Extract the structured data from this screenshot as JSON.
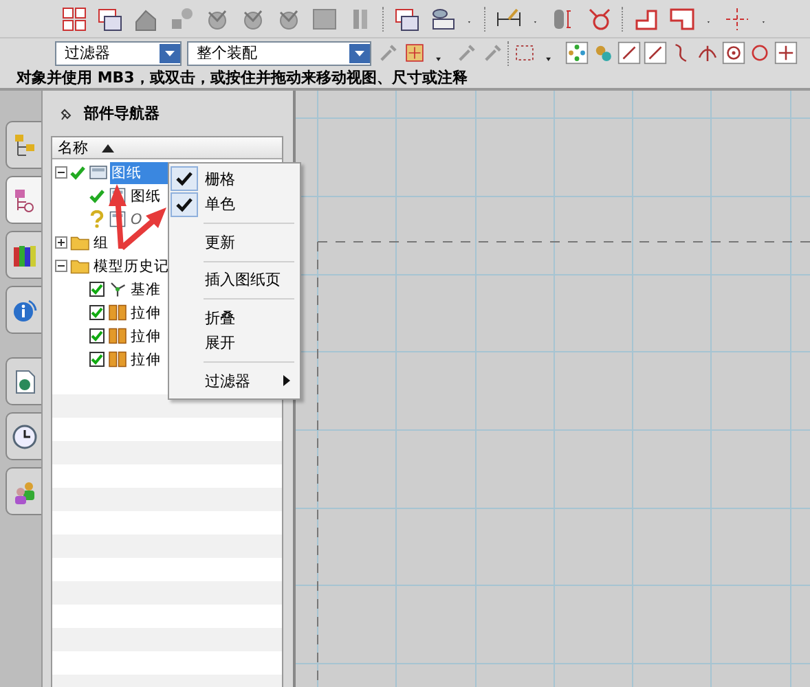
{
  "toolbar": {
    "filter_dropdown": {
      "value": "过滤器"
    },
    "assembly_dropdown": {
      "value": "整个装配"
    }
  },
  "cue_line": "对象并使用 MB3，或双击，或按住并拖动来移动视图、尺寸或注释",
  "resource_bar": {
    "tabs": [
      {
        "selected": false
      },
      {
        "selected": true
      },
      {
        "selected": false
      },
      {
        "selected": false
      },
      {
        "selected": false
      },
      {
        "selected": false
      },
      {
        "selected": false
      }
    ]
  },
  "navigator": {
    "title": "部件导航器",
    "columns": [
      {
        "label": "名称",
        "sorted": true
      }
    ],
    "tree": [
      {
        "label": "图纸",
        "kind": "drawing",
        "up_to_date": true,
        "expanded": true,
        "selected": true,
        "children": [
          {
            "label": "图纸",
            "kind": "sheet",
            "up_to_date": true,
            "selected": false
          },
          {
            "label": "O",
            "kind": "sheet",
            "up_to_date": false,
            "selected": false
          }
        ]
      },
      {
        "label": "组",
        "kind": "folder",
        "expanded": false,
        "selected": false
      },
      {
        "label": "模型历史记",
        "kind": "folder",
        "expanded": true,
        "selected": false,
        "children": [
          {
            "label": "基准",
            "kind": "datum",
            "checked": true,
            "selected": false
          },
          {
            "label": "拉伸",
            "kind": "extrude",
            "checked": true,
            "selected": false
          },
          {
            "label": "拉伸",
            "kind": "extrude",
            "checked": true,
            "selected": false
          },
          {
            "label": "拉伸",
            "kind": "extrude",
            "checked": true,
            "selected": false
          }
        ]
      }
    ]
  },
  "context_menu": {
    "items": [
      {
        "kind": "check",
        "label": "栅格",
        "checked": true
      },
      {
        "kind": "check",
        "label": "单色",
        "checked": true
      },
      {
        "kind": "separator"
      },
      {
        "kind": "command",
        "label": "更新"
      },
      {
        "kind": "separator"
      },
      {
        "kind": "command",
        "label": "插入图纸页"
      },
      {
        "kind": "separator"
      },
      {
        "kind": "command",
        "label": "折叠"
      },
      {
        "kind": "command",
        "label": "展开"
      },
      {
        "kind": "separator"
      },
      {
        "kind": "submenu",
        "label": "过滤器"
      }
    ]
  }
}
